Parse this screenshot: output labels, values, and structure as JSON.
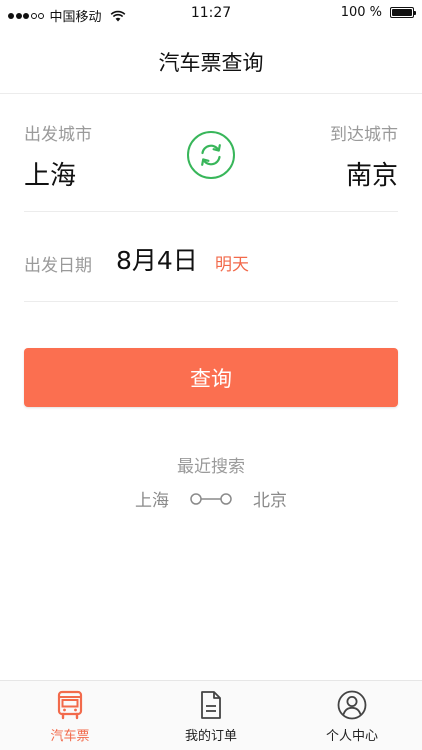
{
  "status_bar": {
    "carrier": "中国移动",
    "time": "11:27",
    "battery": "100 %"
  },
  "nav": {
    "title": "汽车票查询"
  },
  "form": {
    "departure_label": "出发城市",
    "departure_city": "上海",
    "arrival_label": "到达城市",
    "arrival_city": "南京",
    "swap_icon": "refresh-arrows-icon",
    "date_label": "出发日期",
    "date_value": "8月4日",
    "date_hint": "明天"
  },
  "search_button": {
    "label": "查询"
  },
  "recent": {
    "title": "最近搜索",
    "routes": [
      {
        "from": "上海",
        "to": "北京"
      }
    ]
  },
  "tabs": [
    {
      "label": "汽车票",
      "icon": "bus-icon",
      "active": true
    },
    {
      "label": "我的订单",
      "icon": "document-icon",
      "active": false
    },
    {
      "label": "个人中心",
      "icon": "user-icon",
      "active": false
    }
  ],
  "colors": {
    "accent": "#fb6f50",
    "accent_text": "#f26a4b",
    "swap_green": "#38b65a",
    "muted_text": "#9a9a9a"
  }
}
